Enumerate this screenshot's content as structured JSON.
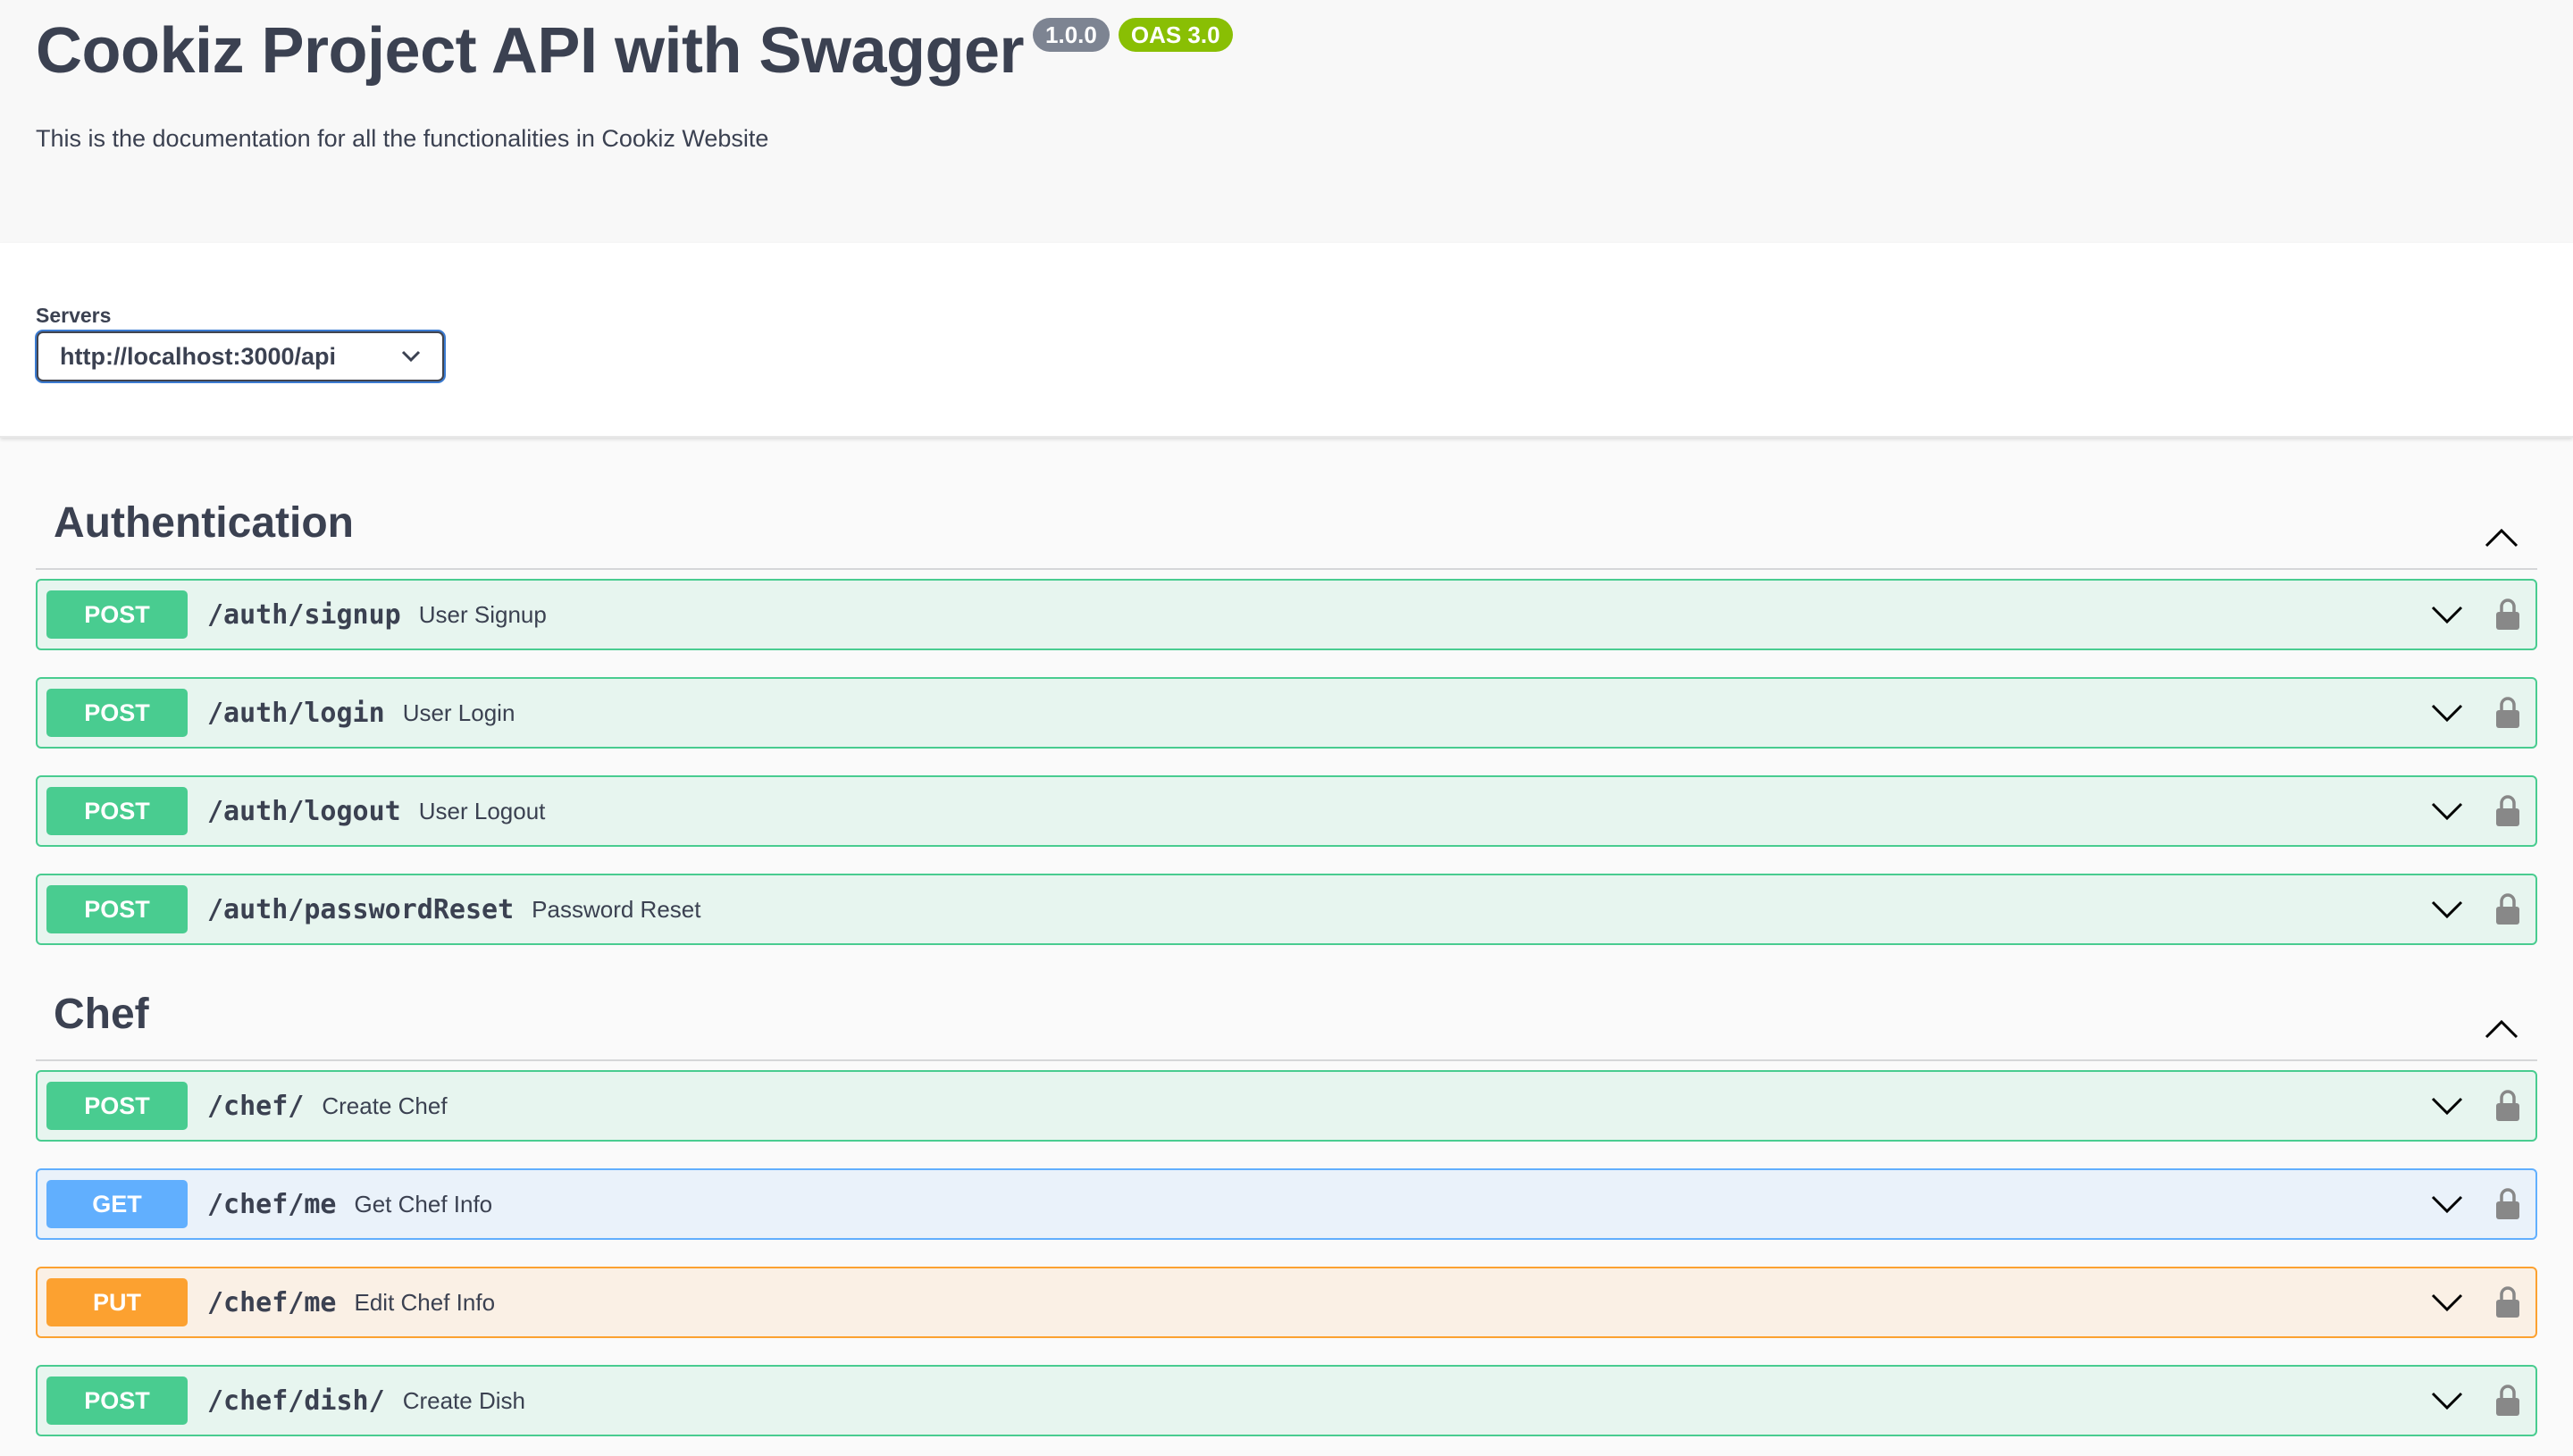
{
  "info": {
    "title": "Cookiz Project API with Swagger",
    "version_badge": "1.0.0",
    "oas_badge": "OAS 3.0",
    "description": "This is the documentation for all the functionalities in Cookiz Website"
  },
  "servers": {
    "label": "Servers",
    "selected": "http://localhost:3000/api"
  },
  "colors": {
    "post": "#49cc90",
    "get": "#61affe",
    "put": "#fca130",
    "version_badge": "#7d8492",
    "oas_badge": "#89bf04"
  },
  "tags": [
    {
      "name": "Authentication",
      "operations": [
        {
          "method": "POST",
          "path": "/auth/signup",
          "summary": "User Signup"
        },
        {
          "method": "POST",
          "path": "/auth/login",
          "summary": "User Login"
        },
        {
          "method": "POST",
          "path": "/auth/logout",
          "summary": "User Logout"
        },
        {
          "method": "POST",
          "path": "/auth/passwordReset",
          "summary": "Password Reset"
        }
      ]
    },
    {
      "name": "Chef",
      "operations": [
        {
          "method": "POST",
          "path": "/chef/",
          "summary": "Create Chef"
        },
        {
          "method": "GET",
          "path": "/chef/me",
          "summary": "Get Chef Info"
        },
        {
          "method": "PUT",
          "path": "/chef/me",
          "summary": "Edit Chef Info"
        },
        {
          "method": "POST",
          "path": "/chef/dish/",
          "summary": "Create Dish"
        }
      ]
    }
  ]
}
